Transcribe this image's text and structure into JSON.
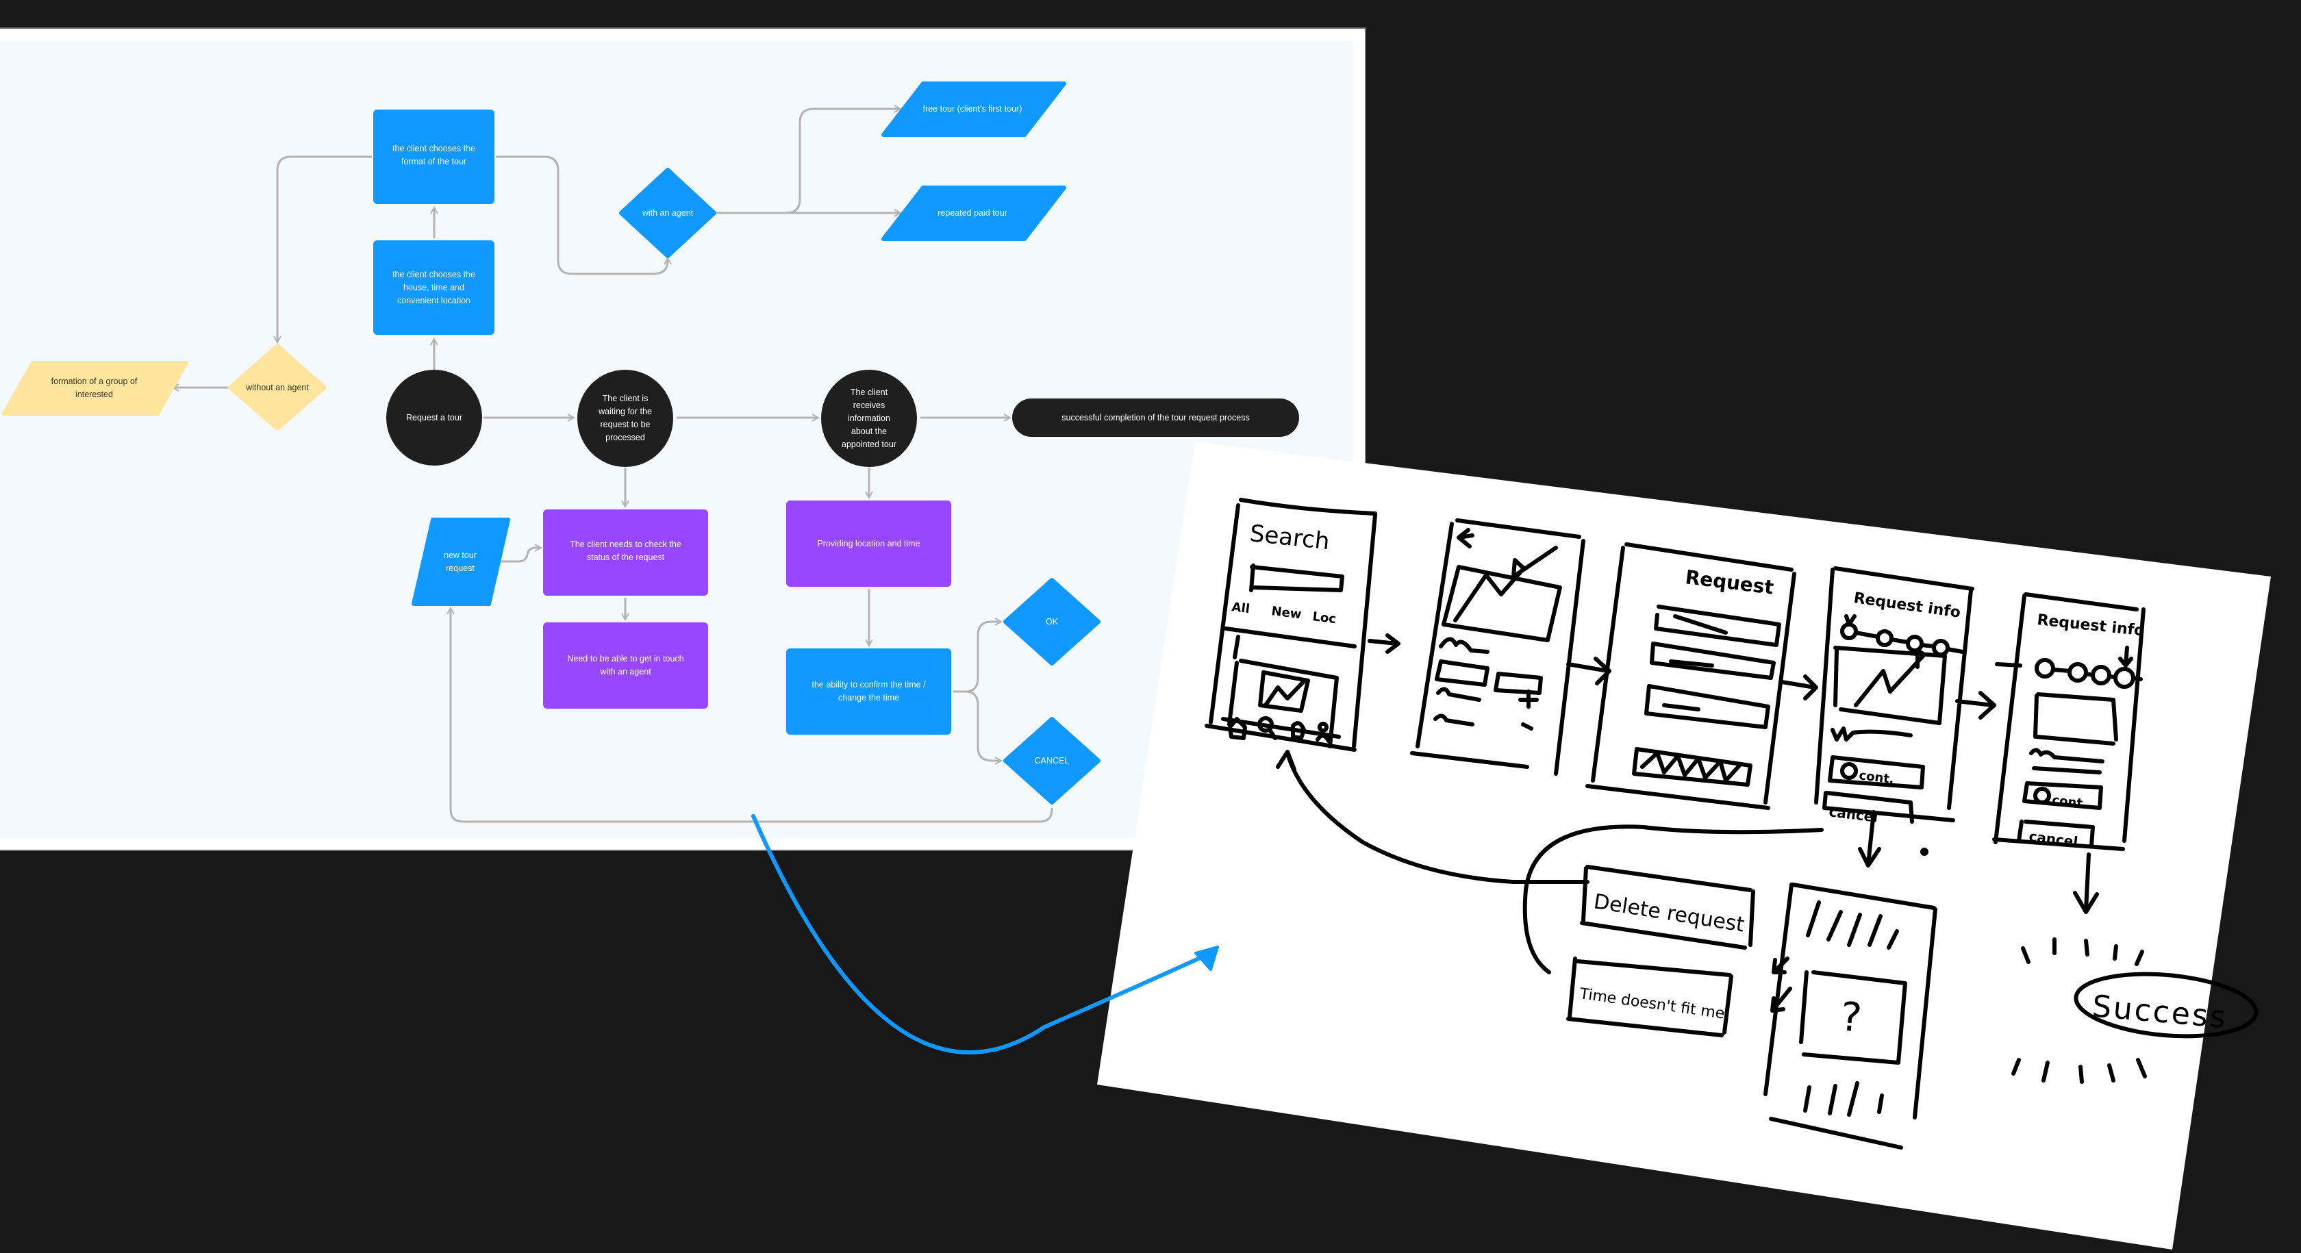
{
  "colors": {
    "background": "#181818",
    "canvas": "#f4f9fe",
    "blue": "#0f99ff",
    "purple": "#9747ff",
    "yellow": "#ffe59e",
    "dark": "#1f1f1f",
    "connector": "#b3b3b3",
    "highlight_arrow": "#0f99ff"
  },
  "flowchart": {
    "nodes": {
      "format": "the client chooses the format of the tour",
      "house": "the client chooses the house, time and convenient location",
      "with_agent": "with an agent",
      "free_tour": "free tour (client's first tour)",
      "paid_tour": "repeated paid tour",
      "group": "formation of a group of interested",
      "without_agent": "without an agent",
      "request": "Request a tour",
      "waiting": "The client is waiting for the request to be processed",
      "receives": "The client receives information about the appointed tour",
      "success": "successful completion of the tour request process",
      "new_request": "new tour request",
      "check_status": "The client needs to check the status of the request",
      "contact_agent": "Need to be able to get in touch with an agent",
      "providing": "Providing location and time",
      "confirm": "the ability to confirm the time / change the time",
      "ok": "OK",
      "cancel": "CANCEL"
    }
  },
  "sketch": {
    "screens": {
      "search_title": "Search",
      "search_tabs": [
        "All",
        "New",
        "Loc"
      ],
      "request_title": "Request",
      "request_info_title": "Request info",
      "request_info_title_2": "Request info",
      "contact_btn": "cont.",
      "cancel_btn": "cancel"
    },
    "notes": {
      "delete_request": "Delete request",
      "time_doesnt_fit": "Time doesn't fit me",
      "unknown": "?",
      "success": "Success"
    }
  }
}
